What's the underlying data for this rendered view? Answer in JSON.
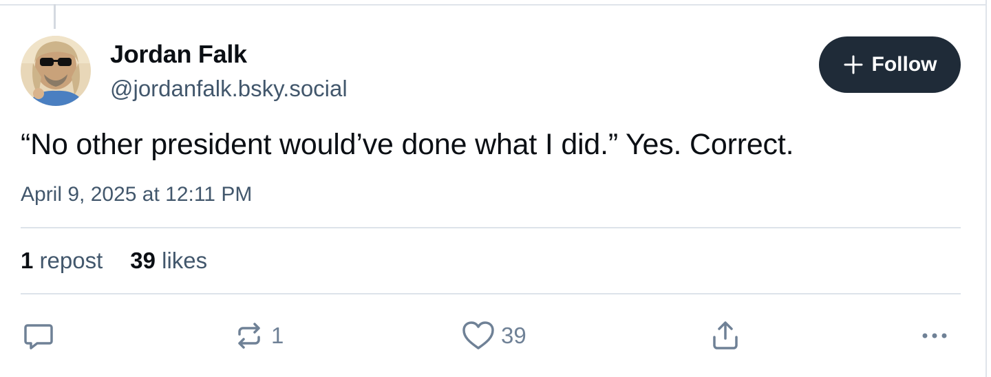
{
  "author": {
    "display_name": "Jordan Falk",
    "handle": "@jordanfalk.bsky.social"
  },
  "follow_button": {
    "label": "Follow",
    "icon": "plus-icon"
  },
  "post": {
    "text": "“No other president would’ve done what I did.” Yes. Correct.",
    "timestamp": "April 9, 2025 at 12:11 PM"
  },
  "stats": {
    "reposts_count": "1",
    "reposts_label": "repost",
    "likes_count": "39",
    "likes_label": "likes"
  },
  "actions": {
    "reply": {
      "icon": "reply-icon"
    },
    "repost": {
      "icon": "repost-icon",
      "count": "1"
    },
    "like": {
      "icon": "heart-icon",
      "count": "39"
    },
    "share": {
      "icon": "share-icon"
    },
    "more": {
      "icon": "more-icon"
    }
  },
  "colors": {
    "follow_button_bg": "#1f2b38",
    "secondary_text": "#42576c",
    "action_icon": "#6f8196",
    "divider": "#dde3ea"
  }
}
